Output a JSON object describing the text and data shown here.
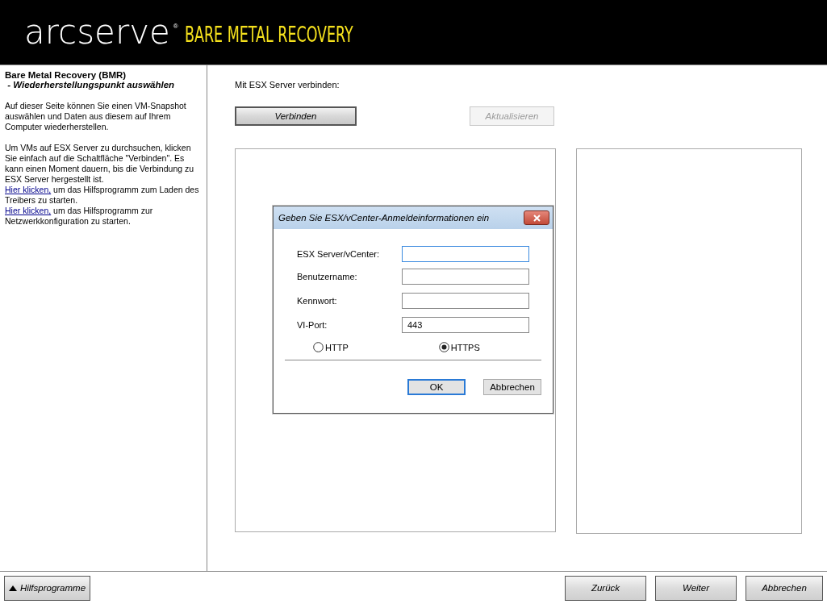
{
  "header": {
    "brand": "arcserve",
    "registered": "®",
    "product": "BARE METAL RECOVERY"
  },
  "sidebar": {
    "title": "Bare Metal Recovery (BMR)",
    "subtitle": " - Wiederherstellungspunkt auswählen",
    "blocks": [
      [
        {
          "kind": "text",
          "text": "Auf dieser Seite können Sie einen VM-Snapshot auswählen und Daten aus diesem auf Ihrem Computer wiederherstellen."
        }
      ],
      [
        {
          "kind": "text",
          "text": "Um VMs auf ESX Server zu durchsuchen, klicken Sie einfach auf die Schaltfläche \"Verbinden\". Es kann einen Moment dauern, bis die Verbindung zu ESX Server hergestellt ist."
        },
        {
          "kind": "link",
          "link": "Hier klicken,",
          "text": "um das Hilfsprogramm zum Laden des Treibers zu starten."
        },
        {
          "kind": "link",
          "link": "Hier klicken,",
          "text": "um das Hilfsprogramm zur Netzwerkkonfiguration zu starten."
        }
      ]
    ]
  },
  "main": {
    "connect_label": "Mit ESX Server verbinden:",
    "buttons": [
      {
        "label": "Verbinden",
        "disabled": false
      },
      {
        "label": "Aktualisieren",
        "disabled": true
      }
    ]
  },
  "dialog": {
    "title": "Geben Sie ESX/vCenter-Anmeldeinformationen ein",
    "fields": [
      {
        "label": "ESX Server/vCenter:",
        "focused": true
      },
      {
        "label": "Benutzername:",
        "focused": false
      },
      {
        "label": "Kennwort:",
        "focused": false
      },
      {
        "label": "VI-Port:",
        "focused": false,
        "value": "443"
      }
    ],
    "protocols": [
      {
        "label": "HTTP",
        "selected": false
      },
      {
        "label": "HTTPS",
        "selected": true
      }
    ],
    "buttons": [
      {
        "label": "OK",
        "default": true
      },
      {
        "label": "Abbrechen",
        "default": false
      }
    ]
  },
  "footer": {
    "tools_button": "Hilfsprogramme",
    "nav_buttons": [
      "Zurück",
      "Weiter",
      "Abbrechen"
    ]
  }
}
